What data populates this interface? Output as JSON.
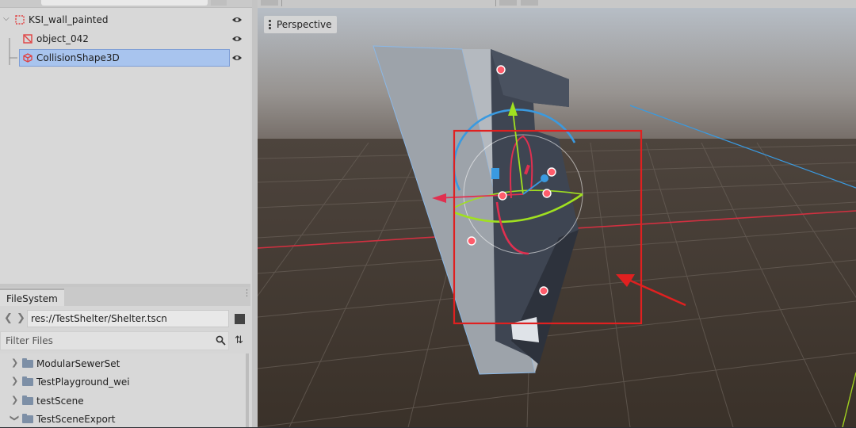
{
  "scene_tree": {
    "items": [
      {
        "label": "KSI_wall_painted",
        "icon": "node3d-icon"
      },
      {
        "label": "object_042",
        "icon": "mesh-instance-icon"
      },
      {
        "label": "CollisionShape3D",
        "icon": "collision-shape-icon",
        "selected": true
      }
    ]
  },
  "filesystem": {
    "tab_label": "FileSystem",
    "path": "res://TestShelter/Shelter.tscn",
    "filter_placeholder": "Filter Files",
    "folders": [
      {
        "label": "ModularSewerSet"
      },
      {
        "label": "TestPlayground_wei"
      },
      {
        "label": "testScene"
      },
      {
        "label": "TestSceneExport"
      }
    ]
  },
  "viewport": {
    "view_mode": "Perspective"
  },
  "colors": {
    "selection": "#a8c4ee",
    "highlight_box": "#e02020",
    "axis_x": "#e03040",
    "axis_y": "#a0e020",
    "axis_z": "#3090e0",
    "floor": "#3a3430"
  }
}
